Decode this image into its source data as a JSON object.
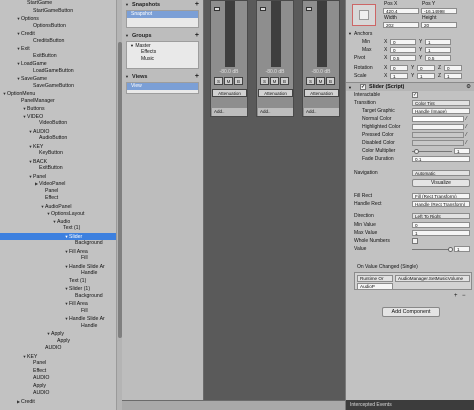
{
  "hierarchy": {
    "items": [
      {
        "label": "StartGame",
        "arrow": ""
      },
      {
        "label": "StartGameButton",
        "arrow": ""
      },
      {
        "label": "Options",
        "arrow": "▼"
      },
      {
        "label": "OptionsButton",
        "arrow": ""
      },
      {
        "label": "Credit",
        "arrow": "▼"
      },
      {
        "label": "CreditsButton",
        "arrow": ""
      },
      {
        "label": "Exit",
        "arrow": "▼"
      },
      {
        "label": "ExitButton",
        "arrow": ""
      },
      {
        "label": "LoadGame",
        "arrow": "▼"
      },
      {
        "label": "LoadGameButton",
        "arrow": ""
      },
      {
        "label": "SaveGame",
        "arrow": "▼"
      },
      {
        "label": "SaveGameButton",
        "arrow": ""
      },
      {
        "label": "OptionMenu",
        "arrow": "▼"
      },
      {
        "label": "PanelManager",
        "arrow": ""
      },
      {
        "label": "Buttons",
        "arrow": "▼"
      },
      {
        "label": "VIDEO",
        "arrow": "▼"
      },
      {
        "label": "VideoButton",
        "arrow": ""
      },
      {
        "label": "AUDIO",
        "arrow": "▼"
      },
      {
        "label": "AudioButton",
        "arrow": ""
      },
      {
        "label": "KEY",
        "arrow": "▼"
      },
      {
        "label": "KeyButton",
        "arrow": ""
      },
      {
        "label": "BACK",
        "arrow": "▼"
      },
      {
        "label": "ExitButton",
        "arrow": ""
      },
      {
        "label": "Panel",
        "arrow": "▼"
      },
      {
        "label": "VideoPanel",
        "arrow": "▶"
      },
      {
        "label": "Panel",
        "arrow": ""
      },
      {
        "label": "Effect",
        "arrow": ""
      },
      {
        "label": "AudioPanel",
        "arrow": "▼"
      },
      {
        "label": "OptionsLayout",
        "arrow": "▼"
      },
      {
        "label": "Audio",
        "arrow": "▼"
      },
      {
        "label": "Text (1)",
        "arrow": ""
      },
      {
        "label": "Slider",
        "arrow": "▼",
        "selected": true
      },
      {
        "label": "Background",
        "arrow": ""
      },
      {
        "label": "Fill Area",
        "arrow": "▼"
      },
      {
        "label": "Fill",
        "arrow": ""
      },
      {
        "label": "Handle Slide Ar",
        "arrow": "▼"
      },
      {
        "label": "Handle",
        "arrow": ""
      },
      {
        "label": "Text (1)",
        "arrow": ""
      },
      {
        "label": "Slider (1)",
        "arrow": "▼"
      },
      {
        "label": "Background",
        "arrow": ""
      },
      {
        "label": "Fill Area",
        "arrow": "▼"
      },
      {
        "label": "Fill",
        "arrow": ""
      },
      {
        "label": "Handle Slide Ar",
        "arrow": "▼"
      },
      {
        "label": "Handle",
        "arrow": ""
      },
      {
        "label": "Apply",
        "arrow": "▼"
      },
      {
        "label": "Apply",
        "arrow": ""
      },
      {
        "label": "AUDIO",
        "arrow": ""
      },
      {
        "label": "KEY",
        "arrow": "▼"
      },
      {
        "label": "Panel",
        "arrow": ""
      },
      {
        "label": "Effect",
        "arrow": ""
      },
      {
        "label": "AUDIO",
        "arrow": ""
      },
      {
        "label": "Apply",
        "arrow": ""
      },
      {
        "label": "AUDIO",
        "arrow": ""
      },
      {
        "label": "Credit",
        "arrow": "▶"
      }
    ]
  },
  "mixer": {
    "snapshots_title": "Snapshots",
    "snapshot_item": "Snapshot",
    "groups_title": "Groups",
    "groups": [
      "Master",
      "Effects",
      "Music"
    ],
    "views_title": "Views",
    "view_item": "View",
    "strips": [
      {
        "db": "-80.0 dB",
        "s": "S",
        "m": "M",
        "b": "B",
        "effect": "Attenuation",
        "add": "Add.."
      },
      {
        "db": "-80.0 dB",
        "s": "S",
        "m": "M",
        "b": "B",
        "effect": "Attenuation",
        "add": "Add.."
      },
      {
        "db": "-80.0 dB",
        "s": "S",
        "m": "M",
        "b": "B",
        "effect": "Attenuation",
        "add": "Add.."
      }
    ]
  },
  "inspector": {
    "posx_label": "Pos X",
    "posy_label": "Pos Y",
    "posx": "420.4",
    "posy": "-16.14998",
    "width_label": "Width",
    "height_label": "Height",
    "width": "202",
    "height": "20",
    "anchors": "Anchors",
    "min": "Min",
    "max": "Max",
    "pivot": "Pivot",
    "min_x": "0",
    "min_y": "1",
    "max_x": "0",
    "max_y": "1",
    "pivot_x": "0.5",
    "pivot_y": "0.5",
    "rotation": "Rotation",
    "scale": "Scale",
    "rot_x": "0",
    "rot_y": "0",
    "rot_z": "0",
    "scale_x": "1",
    "scale_y": "1",
    "scale_z": "1",
    "x": "X",
    "y": "Y",
    "z": "Z",
    "component_title": "Slider (Script)",
    "interactable": "Interactable",
    "transition": "Transition",
    "transition_value": "Color Tint",
    "target_graphic": "Target Graphic",
    "target_graphic_value": "Handle (Image)",
    "normal_color": "Normal Color",
    "highlighted_color": "Highlighted Color",
    "pressed_color": "Pressed Color",
    "disabled_color": "Disabled Color",
    "color_multiplier": "Color Multiplier",
    "color_multiplier_value": "1",
    "fade_duration": "Fade Duration",
    "fade_duration_value": "0.1",
    "navigation": "Navigation",
    "navigation_value": "Automatic",
    "visualize": "Visualize",
    "fill_rect": "Fill Rect",
    "fill_rect_value": "Fill (Rect Transform)",
    "handle_rect": "Handle Rect",
    "handle_rect_value": "Handle (Rect Transform)",
    "direction": "Direction",
    "direction_value": "Left To Right",
    "min_value": "Min Value",
    "min_value_v": "0",
    "max_value": "Max Value",
    "max_value_v": "1",
    "whole_numbers": "Whole Numbers",
    "value": "Value",
    "value_v": "1",
    "slider_fraction": 1.0,
    "on_value_changed": "On Value Changed (Single)",
    "runtime": "Runtime Or",
    "function": "AudioManager.SetMusicVolume",
    "object": "AudioP",
    "add_component": "Add Component",
    "intercepted_events": "Intercepted Events"
  },
  "colors": {
    "selection": "#3d80df",
    "panel": "#c2c2c2",
    "mixer_bg": "#5a5a5a"
  }
}
